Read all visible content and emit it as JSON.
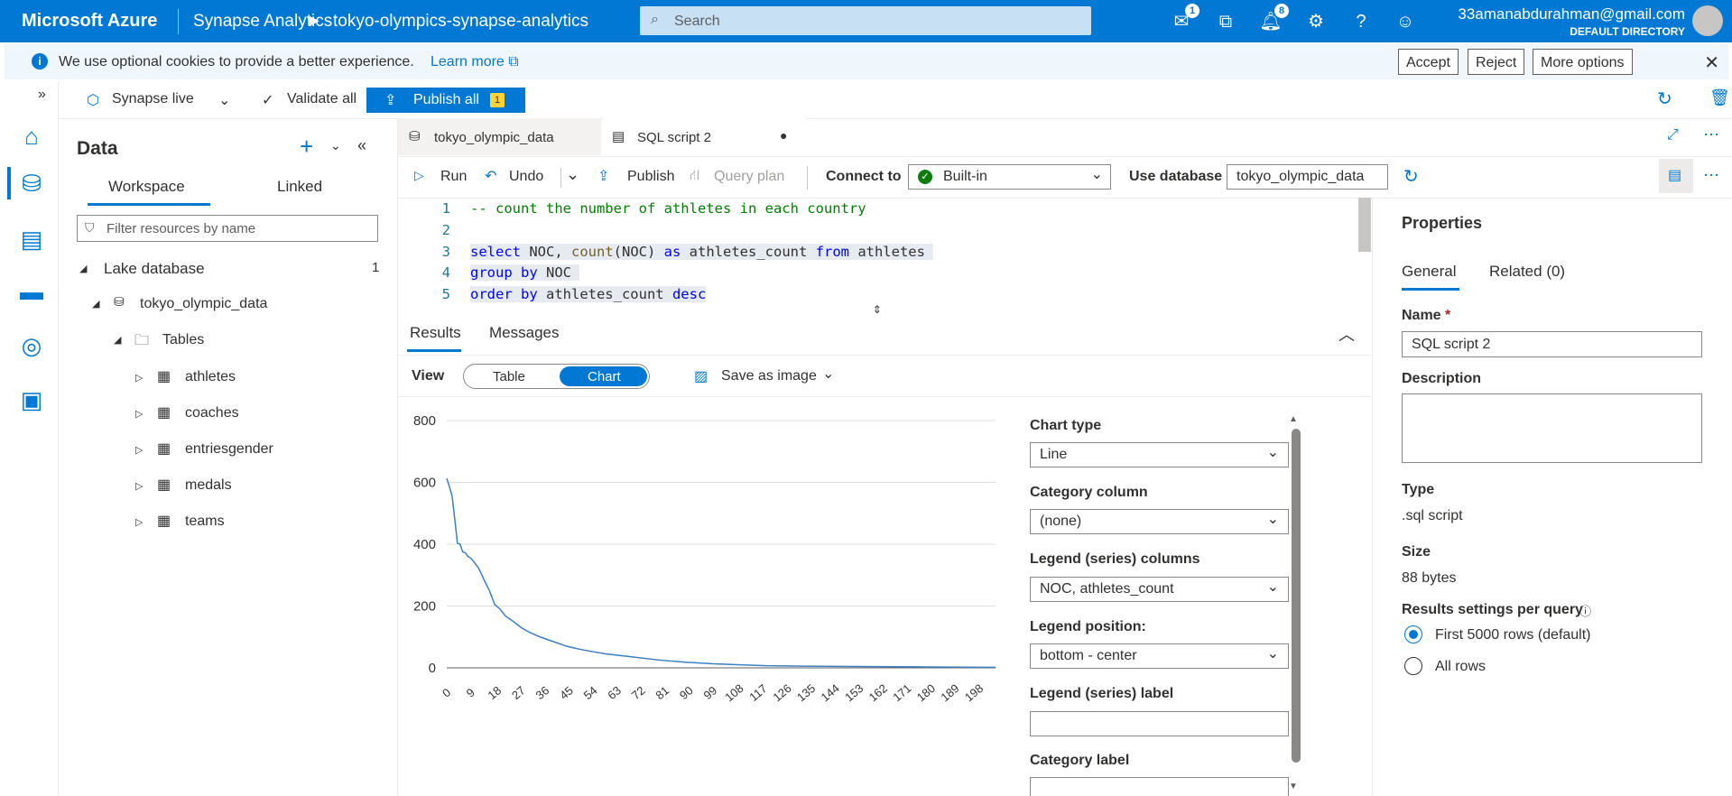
{
  "topbar": {
    "brand": "Microsoft Azure",
    "crumb1": "Synapse Analytics",
    "crumb2": "tokyo-olympics-synapse-analytics",
    "search_placeholder": "Search",
    "feedback_badge": "1",
    "notifications_badge": "8",
    "user_email": "33amanabdurahman@gmail.com",
    "directory": "DEFAULT DIRECTORY"
  },
  "cookie_bar": {
    "message": "We use optional cookies to provide a better experience.",
    "learn_more": "Learn more",
    "accept": "Accept",
    "reject": "Reject",
    "more_options": "More options"
  },
  "toolbar": {
    "live_mode": "Synapse live",
    "validate_all": "Validate all",
    "publish_all": "Publish all",
    "publish_count": "1"
  },
  "data_panel": {
    "title": "Data",
    "tabs": [
      "Workspace",
      "Linked"
    ],
    "filter_placeholder": "Filter resources by name",
    "section": "Lake database",
    "section_count": "1",
    "database": "tokyo_olympic_data",
    "tables_folder": "Tables",
    "tables": [
      "athletes",
      "coaches",
      "entriesgender",
      "medals",
      "teams"
    ]
  },
  "editor_tabs": {
    "tab1": "tokyo_olympic_data",
    "tab2": "SQL script 2"
  },
  "editor_toolbar": {
    "run": "Run",
    "undo": "Undo",
    "publish": "Publish",
    "query_plan": "Query plan",
    "connect_to_label": "Connect to",
    "connect_to_value": "Built-in",
    "use_database_label": "Use database",
    "use_database_value": "tokyo_olympic_data"
  },
  "code_lines": [
    "1",
    "2",
    "3",
    "4",
    "5"
  ],
  "results": {
    "tabs": [
      "Results",
      "Messages"
    ],
    "view_label": "View",
    "view_table": "Table",
    "view_chart": "Chart",
    "save_as_image": "Save as image"
  },
  "chart_settings": {
    "chart_type_label": "Chart type",
    "chart_type_value": "Line",
    "category_column_label": "Category column",
    "category_column_value": "(none)",
    "legend_columns_label": "Legend (series) columns",
    "legend_columns_value": "NOC, athletes_count",
    "legend_position_label": "Legend position:",
    "legend_position_value": "bottom - center",
    "legend_label_label": "Legend (series) label",
    "category_label_label": "Category label"
  },
  "chart_data": {
    "type": "line",
    "ylim": [
      0,
      800
    ],
    "yticks": [
      0,
      200,
      400,
      600,
      800
    ],
    "xticks": [
      "0",
      "9",
      "18",
      "27",
      "36",
      "45",
      "54",
      "63",
      "72",
      "81",
      "90",
      "99",
      "108",
      "117",
      "126",
      "135",
      "144",
      "153",
      "162",
      "171",
      "180",
      "189",
      "198"
    ],
    "grid": true,
    "series": [
      {
        "color": "#3b7fc4",
        "x": [
          0,
          1,
          2,
          3,
          4,
          5,
          6,
          7,
          8,
          9,
          10,
          12,
          14,
          16,
          18,
          20,
          22,
          25,
          28,
          31,
          35,
          40,
          45,
          50,
          55,
          60,
          70,
          80,
          90,
          100,
          110,
          120,
          140,
          160,
          180,
          200,
          206
        ],
        "values": [
          613,
          586,
          556,
          482,
          403,
          400,
          375,
          372,
          360,
          355,
          345,
          322,
          285,
          250,
          205,
          190,
          168,
          150,
          130,
          115,
          100,
          85,
          70,
          60,
          52,
          45,
          35,
          25,
          18,
          13,
          10,
          7,
          5,
          4,
          3,
          2,
          2
        ]
      }
    ]
  },
  "properties": {
    "title": "Properties",
    "tabs": [
      "General",
      "Related (0)"
    ],
    "name_label": "Name",
    "name_value": "SQL script 2",
    "description_label": "Description",
    "type_label": "Type",
    "type_value": ".sql script",
    "size_label": "Size",
    "size_value": "88 bytes",
    "results_settings_label": "Results settings per query",
    "option1": "First 5000 rows (default)",
    "option2": "All rows"
  }
}
